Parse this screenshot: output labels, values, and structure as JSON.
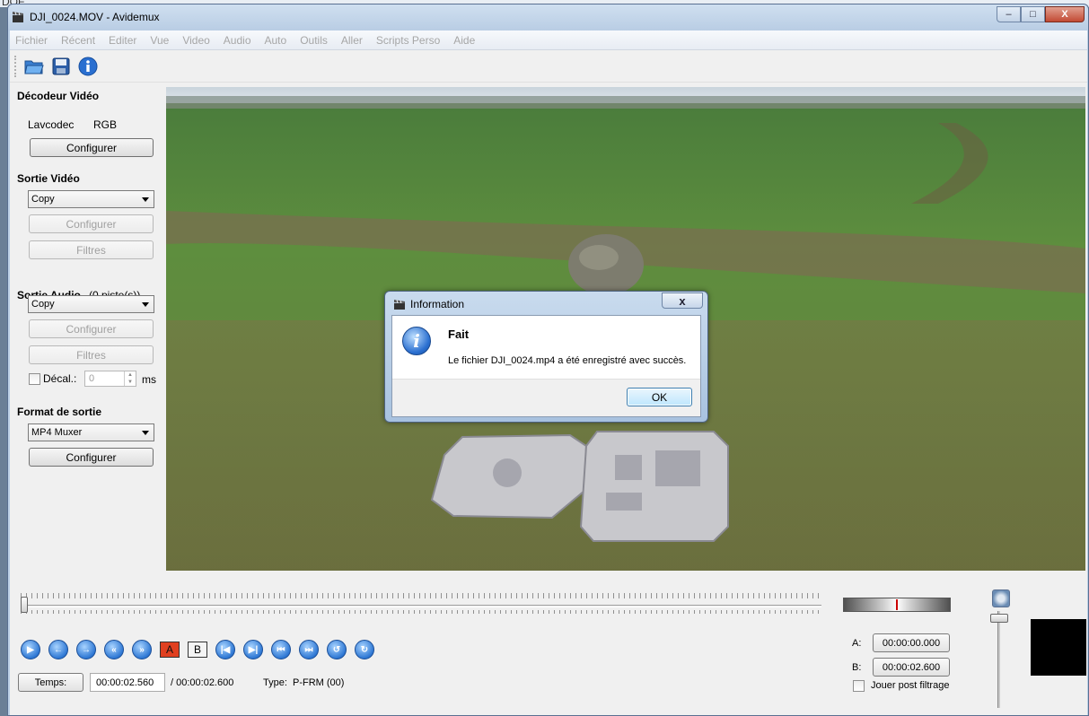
{
  "desktop": {
    "corner_text": "DOF"
  },
  "window": {
    "title": "DJI_0024.MOV - Avidemux",
    "buttons": {
      "minimize": "–",
      "maximize": "□",
      "close": "X"
    }
  },
  "menu": [
    "Fichier",
    "Récent",
    "Editer",
    "Vue",
    "Video",
    "Audio",
    "Auto",
    "Outils",
    "Aller",
    "Scripts Perso",
    "Aide"
  ],
  "toolbar": {
    "icons": [
      "open-folder-icon",
      "save-icon",
      "info-icon"
    ]
  },
  "left": {
    "decoder_title": "Décodeur Vidéo",
    "decoder_name": "Lavcodec",
    "decoder_format": "RGB",
    "decoder_configure": "Configurer",
    "video_out_title": "Sortie Vidéo",
    "video_codec": "Copy",
    "video_configure": "Configurer",
    "video_filters": "Filtres",
    "audio_out_title": "Sortie Audio",
    "audio_tracks": "(0 piste(s))",
    "audio_codec": "Copy",
    "audio_configure": "Configurer",
    "audio_filters": "Filtres",
    "shift_label": "Décal.:",
    "shift_value": "0",
    "shift_unit": "ms",
    "format_title": "Format de sortie",
    "muxer": "MP4 Muxer",
    "muxer_configure": "Configurer"
  },
  "controls": {
    "marker_a": "A",
    "marker_b": "B",
    "time_button": "Temps:",
    "current_time": "00:00:02.560",
    "total_time": "/ 00:00:02.600",
    "frame_type": "Type:  P-FRM (00)",
    "a_label": "A:",
    "a_time": "00:00:00.000",
    "b_label": "B:",
    "b_time": "00:00:02.600",
    "play_filtered": "Jouer post filtrage"
  },
  "dialog": {
    "title": "Information",
    "close": "x",
    "heading": "Fait",
    "message": "Le fichier DJI_0024.mp4 a été enregistré avec succès.",
    "ok": "OK"
  },
  "colors": {
    "accent": "#2f78d4",
    "title_bar": "#bcd0e6",
    "marker_a_bg": "#e04020"
  }
}
